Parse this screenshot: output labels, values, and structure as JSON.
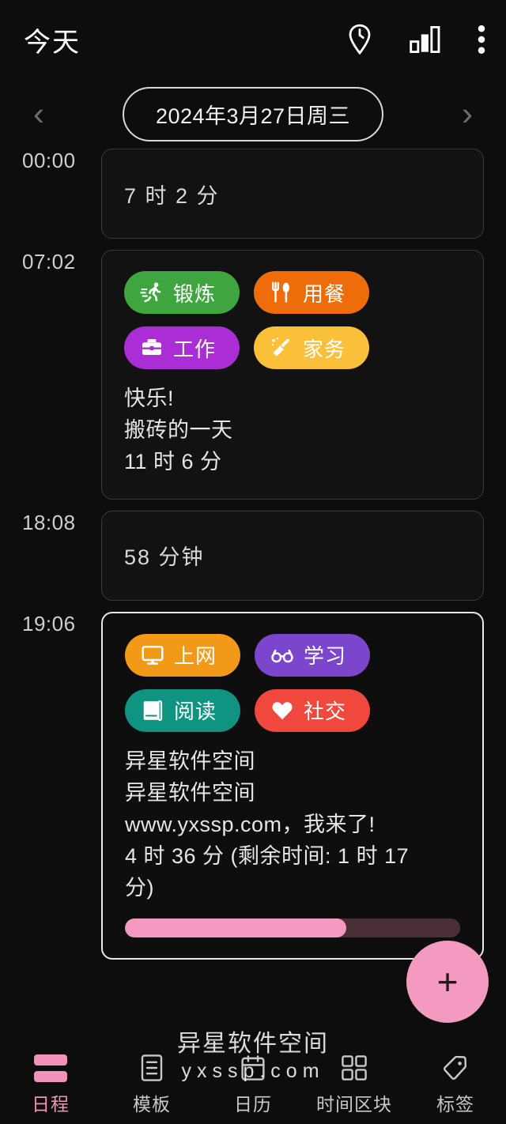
{
  "header": {
    "title": "今天",
    "icons": [
      {
        "name": "location-clock-icon"
      },
      {
        "name": "stats-bar-icon"
      },
      {
        "name": "overflow-menu-icon"
      }
    ]
  },
  "date_nav": {
    "prev_label": "‹",
    "next_label": "›",
    "current_date": "2024年3月27日周三"
  },
  "timeline": {
    "entries": [
      {
        "time": "00:00",
        "type": "idle",
        "duration": "7 时 2 分",
        "active": false
      },
      {
        "time": "07:02",
        "type": "event",
        "active": false,
        "chips": [
          {
            "label": "锻炼",
            "icon": "run-icon",
            "color": "#3fa63f"
          },
          {
            "label": "用餐",
            "icon": "cutlery-icon",
            "color": "#ef6c0a"
          },
          {
            "label": "工作",
            "icon": "briefcase-icon",
            "color": "#ab2dd6"
          },
          {
            "label": "家务",
            "icon": "broom-icon",
            "color": "#fbc03a"
          }
        ],
        "lines": [
          "快乐!",
          "搬砖的一天",
          "11 时 6 分"
        ]
      },
      {
        "time": "18:08",
        "type": "idle",
        "duration": "58 分钟",
        "active": false
      },
      {
        "time": "19:06",
        "type": "event",
        "active": true,
        "chips": [
          {
            "label": "上网",
            "icon": "monitor-icon",
            "color": "#f29a18"
          },
          {
            "label": "学习",
            "icon": "glasses-icon",
            "color": "#7b45cc"
          },
          {
            "label": "阅读",
            "icon": "book-icon",
            "color": "#0e9480"
          },
          {
            "label": "社交",
            "icon": "heart-icon",
            "color": "#f0483c"
          }
        ],
        "lines": [
          "异星软件空间",
          "异星软件空间",
          "www.yxssp.com，我来了!",
          "4 时 36 分 (剩余时间: 1 时 17 分)"
        ],
        "progress_percent": 66,
        "progress_fill_color": "#f49ac1",
        "progress_track_color": "#4a2e38"
      }
    ]
  },
  "fab": {
    "label": "+",
    "name": "add-entry-button",
    "color": "#f49ac1"
  },
  "watermark": {
    "line1": "异星软件空间",
    "line2": "yxssp.com"
  },
  "bottom_nav": {
    "active_color": "#f291b9",
    "items": [
      {
        "label": "日程",
        "icon": "schedule-icon",
        "active": true
      },
      {
        "label": "模板",
        "icon": "template-icon",
        "active": false
      },
      {
        "label": "日历",
        "icon": "calendar-icon",
        "active": false
      },
      {
        "label": "时间区块",
        "icon": "time-block-icon",
        "active": false
      },
      {
        "label": "标签",
        "icon": "tag-icon",
        "active": false
      }
    ]
  }
}
